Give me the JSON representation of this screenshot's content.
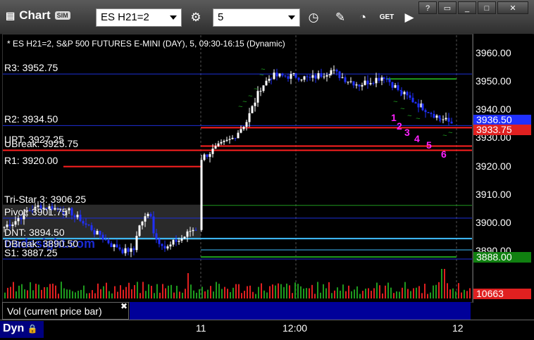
{
  "app": {
    "title": "Chart",
    "badge": "SIM"
  },
  "toolbar": {
    "symbol": "ES H21=2",
    "interval": "5"
  },
  "chart": {
    "header": "* ES H21=2, S&P 500 FUTURES E-MINI (DAY), 5, 09:30-16:15 (Dynamic)",
    "watermark": "tradesight.com",
    "y_ticks": [
      "3960.00",
      "3950.00",
      "3940.00",
      "3930.00",
      "3920.00",
      "3910.00",
      "3900.00",
      "3890.00"
    ],
    "x_ticks": [
      "11",
      "12:00",
      "12"
    ],
    "last_price": "3936.50",
    "red_tag": "3933.75",
    "green_tag": "3888.00",
    "volume_tag": "10663",
    "levels": [
      {
        "label": "R3: 3952.75",
        "value": 3952.75,
        "color": "#1e2fd8"
      },
      {
        "label": "R2: 3934.50",
        "value": 3934.5,
        "color": "#1e2fd8"
      },
      {
        "label": "UPT: 3927.25",
        "value": 3927.25,
        "color": "#ff2020"
      },
      {
        "label": "UBreak: 3925.75",
        "value": 3925.75,
        "color": "#ff2020"
      },
      {
        "label": "R1: 3920.00",
        "value": 3920.0,
        "color": "#ff2020"
      },
      {
        "label": "Tri-Star 3: 3906.25",
        "value": 3906.25,
        "color": "#1e9a1e"
      },
      {
        "label": "Pivot: 3901.75",
        "value": 3901.75,
        "color": "#1e2fd8"
      },
      {
        "label": "DNT: 3894.50",
        "value": 3894.5,
        "color": "#40c0ff"
      },
      {
        "label": "DBreak: 3890.50",
        "value": 3890.5,
        "color": "#40c0ff"
      },
      {
        "label": "S1: 3887.25",
        "value": 3887.25,
        "color": "#1e2fd8"
      }
    ],
    "magenta_numbers": [
      "1",
      "2",
      "3",
      "4",
      "5",
      "6"
    ],
    "vol_label": "Vol (current price bar)",
    "bottom_label": "Dyn"
  },
  "colors": {
    "bull": "#ffffff",
    "bear": "#2030ff",
    "magenta": "#ff22ff",
    "green": "#1e9a1e"
  }
}
